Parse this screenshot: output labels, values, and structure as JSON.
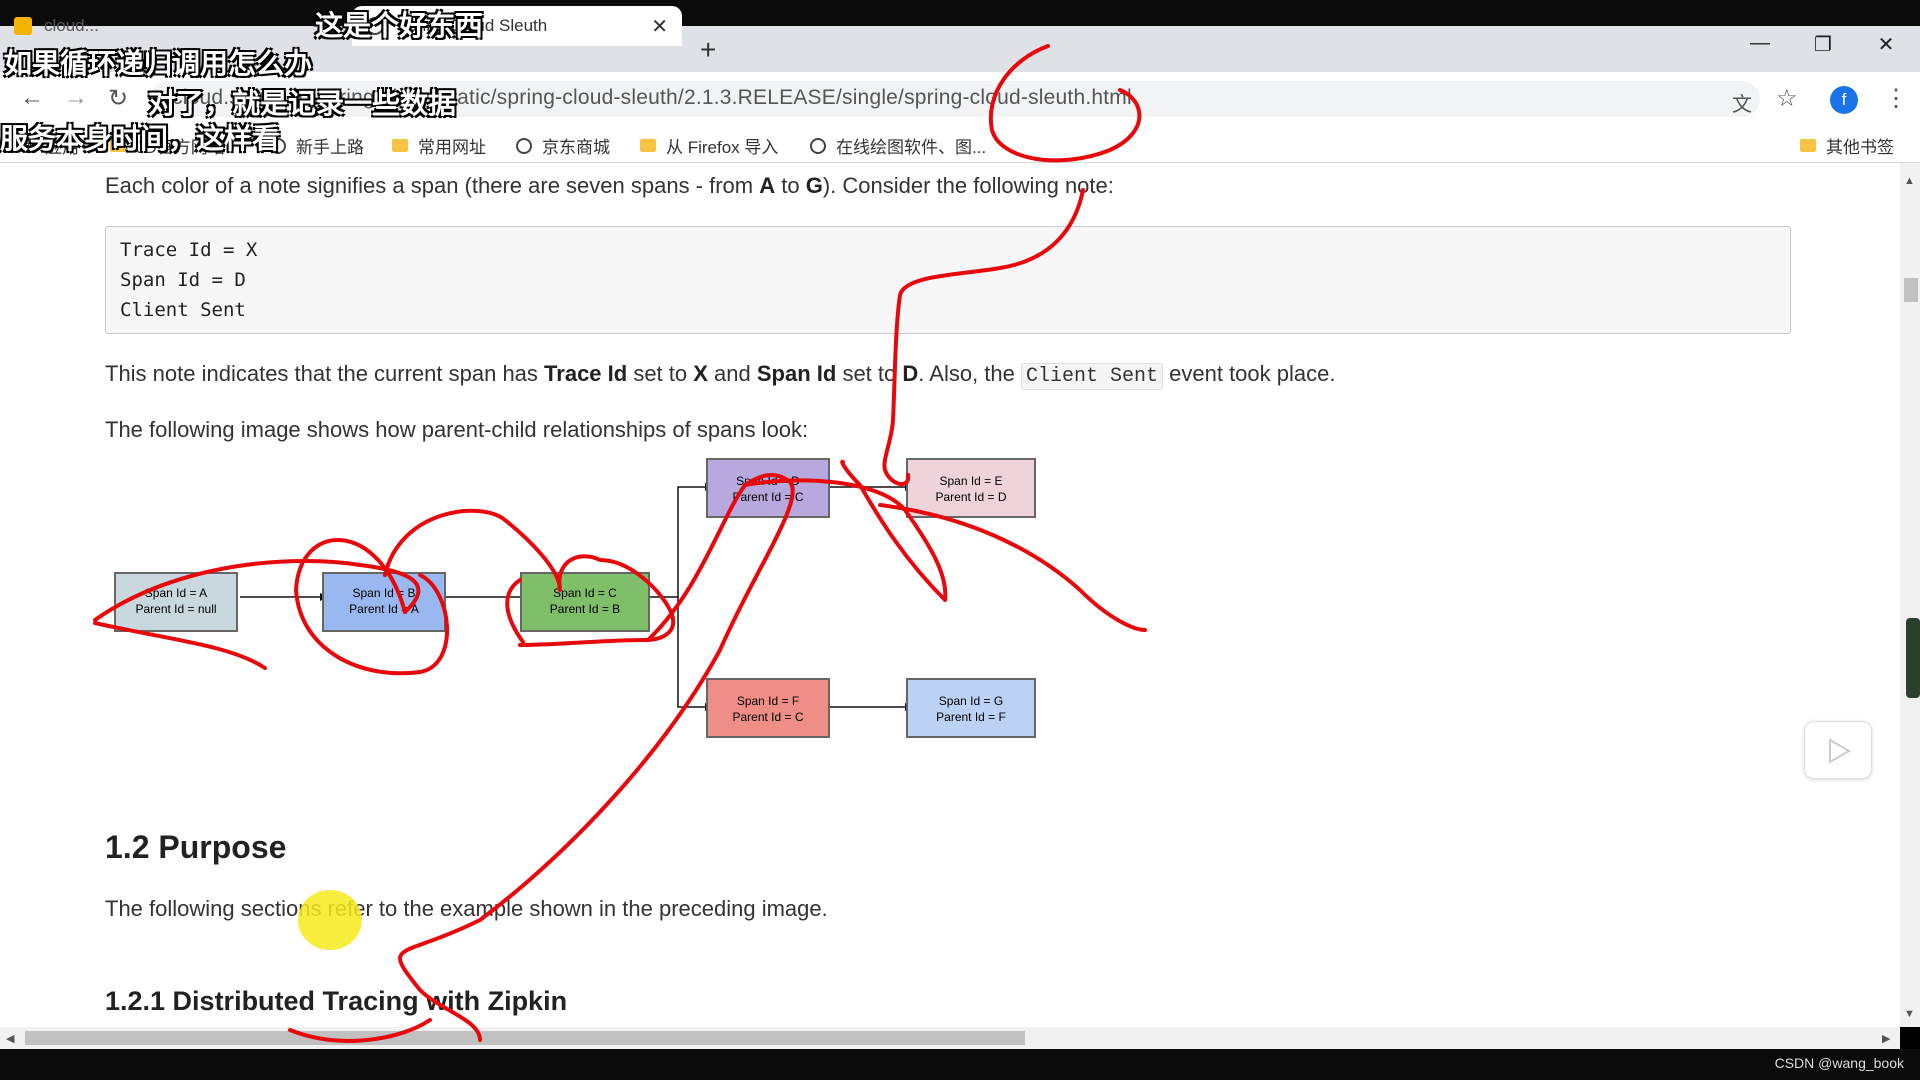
{
  "tabs": [
    {
      "label": "cloud...",
      "active": false
    },
    {
      "label": "Spring Cloud Sleuth",
      "active": true
    }
  ],
  "address": {
    "url": "cloud.spring.io/spring-cloud-static/spring-cloud-sleuth/2.1.3.RELEASE/single/spring-cloud-sleuth.html"
  },
  "profile": {
    "initial": "f",
    "color": "#1a73e8"
  },
  "bookmarks": [
    {
      "label": "应用",
      "icon": "apps-icon"
    },
    {
      "label": "JD官方网站",
      "icon": "folder-icon"
    },
    {
      "label": "新手上路",
      "icon": "globe-icon"
    },
    {
      "label": "常用网址",
      "icon": "folder-icon"
    },
    {
      "label": "京东商城",
      "icon": "globe-icon"
    },
    {
      "label": "从 Firefox 导入",
      "icon": "folder-icon"
    },
    {
      "label": "在线绘图软件、图...",
      "icon": "globe-icon"
    },
    {
      "label": "其他书签",
      "icon": "folder-icon"
    }
  ],
  "content": {
    "intro": {
      "before": "Each color of a note signifies a span (there are seven spans - from ",
      "a": "A",
      "mid": " to ",
      "g": "G",
      "after": "). Consider the following note:"
    },
    "code_lines": [
      "Trace Id = X",
      "Span Id = D",
      "Client Sent"
    ],
    "note": {
      "p1": "This note indicates that the current span has ",
      "b1": "Trace Id",
      "p2": " set to ",
      "b2": "X",
      "p3": " and ",
      "b3": "Span Id",
      "p4": " set to ",
      "b4": "D",
      "p5": ". Also, the ",
      "code": "Client Sent",
      "p6": " event took place."
    },
    "image_intro": "The following image shows how parent-child relationships of spans look:",
    "diagram_nodes": [
      {
        "line1": "Span Id = A",
        "line2": "Parent Id = null",
        "color": "#c9d8de"
      },
      {
        "line1": "Span Id = B",
        "line2": "Parent Id = A",
        "color": "#99b8f0"
      },
      {
        "line1": "Span Id = C",
        "line2": "Parent Id = B",
        "color": "#7fbf6a"
      },
      {
        "line1": "Span Id = D",
        "line2": "Parent Id = C",
        "color": "#b7a9dd"
      },
      {
        "line1": "Span Id = E",
        "line2": "Parent Id = D",
        "color": "#efd3da"
      },
      {
        "line1": "Span Id = F",
        "line2": "Parent Id = C",
        "color": "#ee8e86"
      },
      {
        "line1": "Span Id = G",
        "line2": "Parent Id = F",
        "color": "#bcd2f5"
      }
    ],
    "h_purpose": "1.2 Purpose",
    "purpose_text": "The following sections refer to the example shown in the preceding image.",
    "h_zipkin": "1.2.1 Distributed Tracing with Zipkin"
  },
  "captions": [
    "这是个好东西",
    "如果循环递归调用怎么办",
    "对了，就是记录一些数据",
    "服务本身时间，这样看"
  ],
  "watermark": "CSDN @wang_book",
  "colors": {
    "annotation": "#e8080c",
    "highlighter": "#f5ea1a"
  }
}
